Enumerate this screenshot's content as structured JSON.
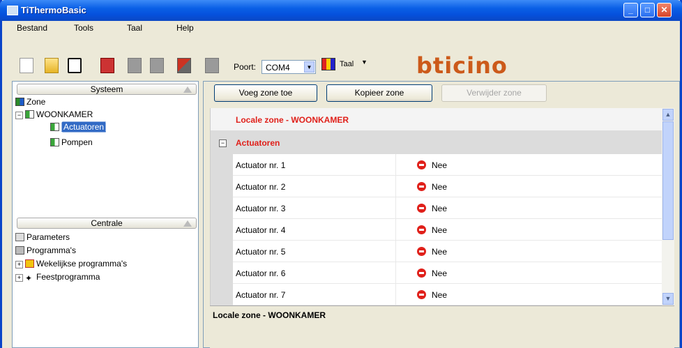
{
  "window": {
    "title": "TiThermoBasic",
    "min": "_",
    "max": "□",
    "close": "✕"
  },
  "menu": [
    "Bestand",
    "Tools",
    "Taal",
    "Help"
  ],
  "toolbar": {
    "poort_label": "Poort:",
    "poort_value": "COM4",
    "taal_label": "Taal",
    "logo": "bticino"
  },
  "left": {
    "systeem_header": "Systeem",
    "tree": {
      "zone": "Zone",
      "room": "WOONKAMER",
      "actuatoren": "Actuatoren",
      "pompen": "Pompen"
    },
    "centrale_header": "Centrale",
    "centrale": {
      "parameters": "Parameters",
      "programmas": "Programma's",
      "wekelijkse": "Wekelijkse programma's",
      "feest": "Feestprogramma"
    }
  },
  "buttons": {
    "add": "Voeg zone toe",
    "copy": "Kopieer zone",
    "delete": "Verwijder zone"
  },
  "grid": {
    "title": "Locale zone - WOONKAMER",
    "section": "Actuatoren",
    "rows": [
      {
        "name": "Actuator nr. 1",
        "value": "Nee"
      },
      {
        "name": "Actuator nr. 2",
        "value": "Nee"
      },
      {
        "name": "Actuator nr. 3",
        "value": "Nee"
      },
      {
        "name": "Actuator nr. 4",
        "value": "Nee"
      },
      {
        "name": "Actuator nr. 5",
        "value": "Nee"
      },
      {
        "name": "Actuator nr. 6",
        "value": "Nee"
      },
      {
        "name": "Actuator nr. 7",
        "value": "Nee"
      }
    ]
  },
  "description": "Locale zone - WOONKAMER"
}
